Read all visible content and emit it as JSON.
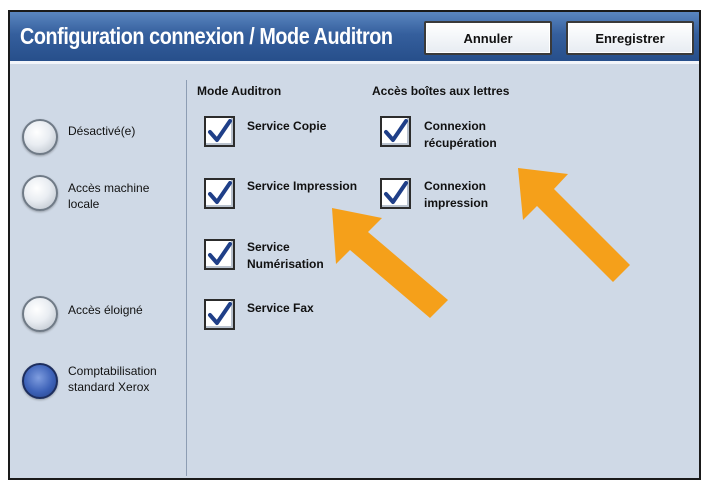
{
  "header": {
    "title": "Configuration connexion / Mode Auditron",
    "cancel_label": "Annuler",
    "save_label": "Enregistrer"
  },
  "modes": [
    {
      "label": "Désactivé(e)",
      "selected": false
    },
    {
      "label": "Accès machine\nlocale",
      "selected": false
    },
    {
      "label": "Accès éloigné",
      "selected": false
    },
    {
      "label": "Comptabilisation\nstandard Xerox",
      "selected": true
    }
  ],
  "auditron": {
    "heading": "Mode Auditron",
    "services": [
      {
        "label": "Service Copie",
        "checked": true
      },
      {
        "label": "Service Impression",
        "checked": true
      },
      {
        "label": "Service\nNumérisation",
        "checked": true
      },
      {
        "label": "Service Fax",
        "checked": true
      }
    ]
  },
  "mailboxes": {
    "heading": "Accès boîtes aux lettres",
    "items": [
      {
        "label": "Connexion\nrécupération",
        "checked": true
      },
      {
        "label": "Connexion\nimpression",
        "checked": true
      }
    ]
  },
  "annotation_color": "#f5a01a",
  "icons": [
    "checkmark-icon",
    "arrow-icon"
  ]
}
